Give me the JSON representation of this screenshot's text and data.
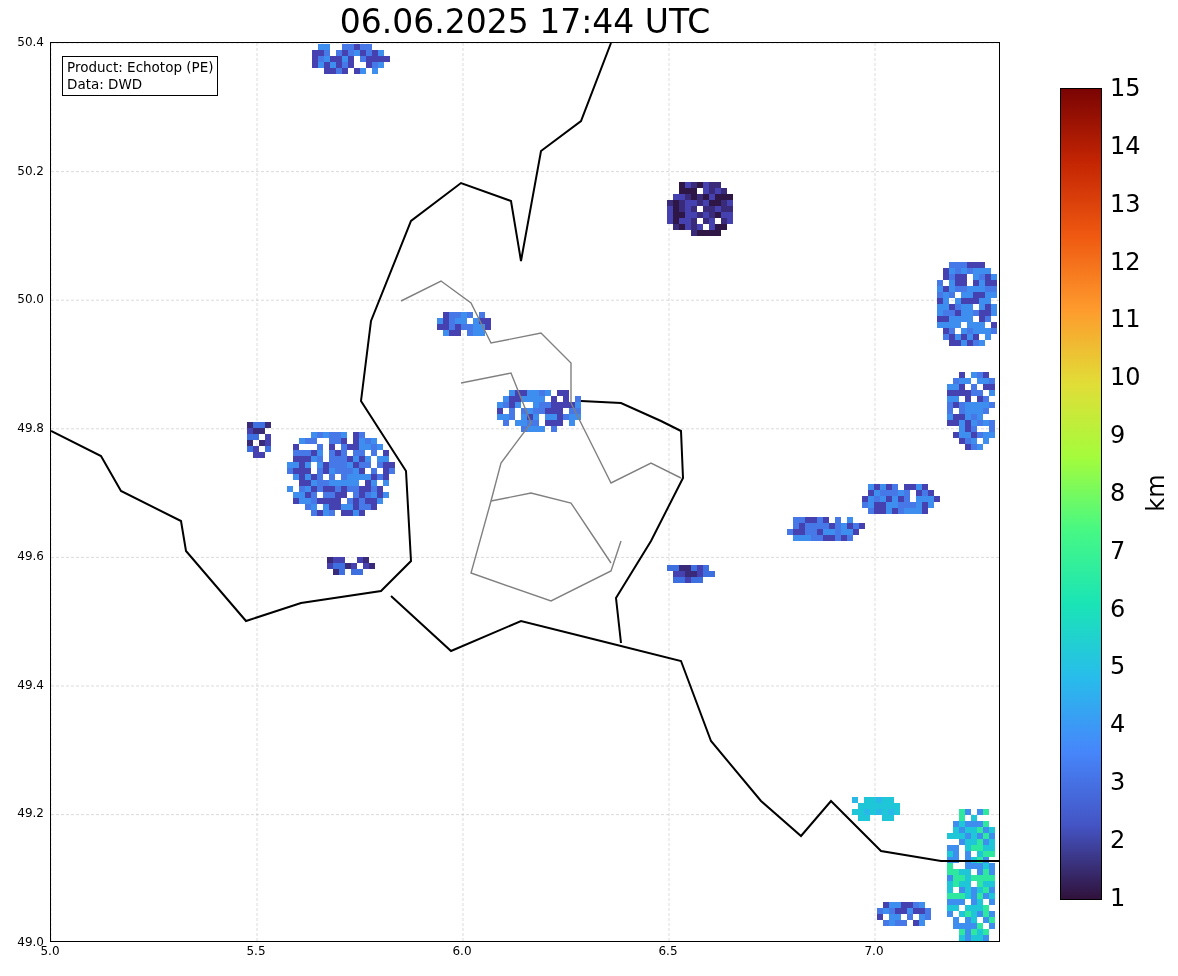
{
  "title": "06.06.2025 17:44 UTC",
  "info_box": {
    "lines": [
      "Product: Echotop (PE)",
      "Data: DWD"
    ]
  },
  "map": {
    "y_ticks": [
      "50.4",
      "50.2",
      "50.0",
      "49.8",
      "49.6",
      "49.4",
      "49.2",
      "49.0"
    ],
    "x_ticks": [
      "5.0",
      "5.5",
      "6.0",
      "6.5",
      "7.0"
    ]
  },
  "colorbar": {
    "ticks": [
      "15",
      "14",
      "13",
      "12",
      "11",
      "10",
      "9",
      "8",
      "7",
      "6",
      "5",
      "4",
      "3",
      "2",
      "1"
    ],
    "label": "km"
  }
}
